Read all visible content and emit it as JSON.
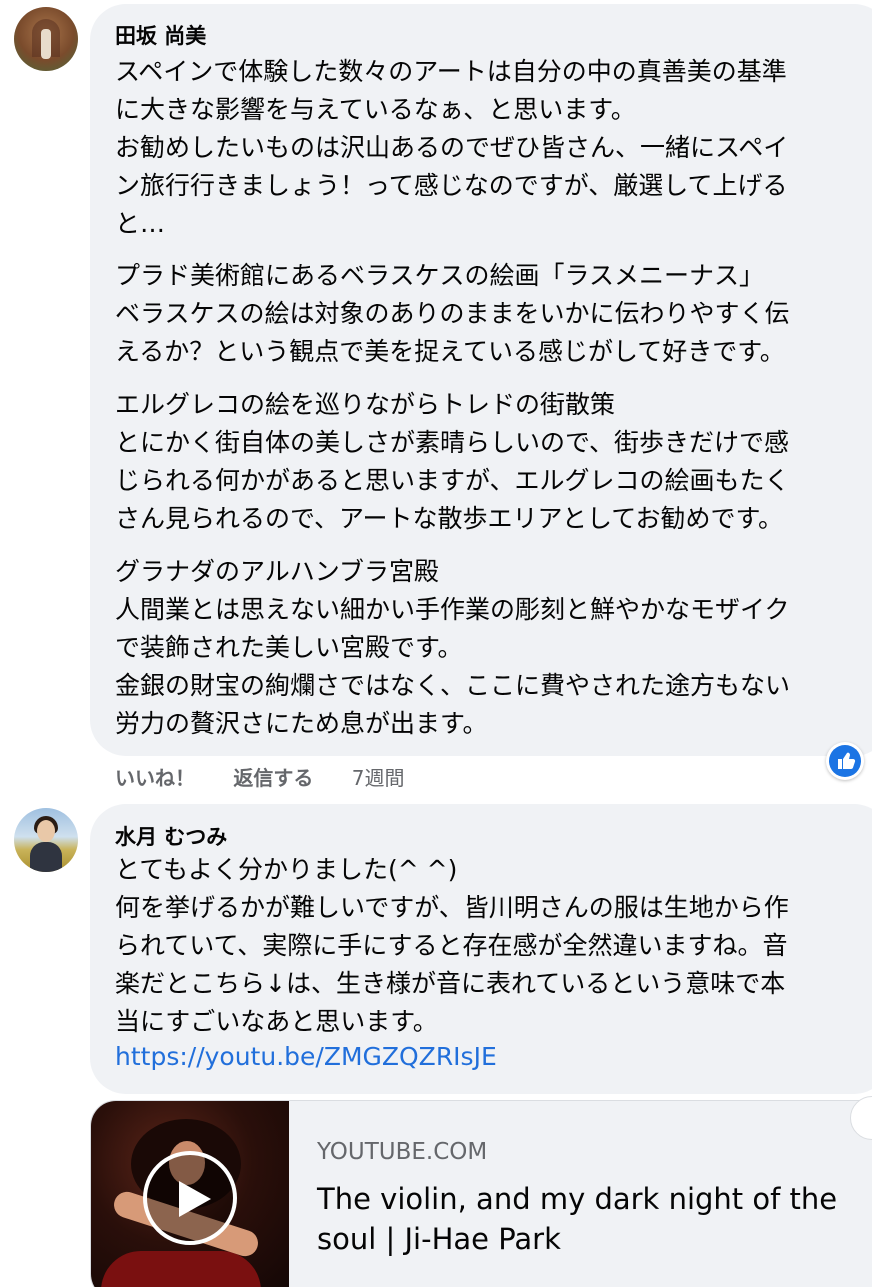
{
  "comments": [
    {
      "author": "田坂 尚美",
      "lines": [
        "スペインで体験した数々のアートは自分の中の真善美の基準",
        "に大きな影響を与えているなぁ、と思います。",
        "お勧めしたいものは沢山あるのでぜひ皆さん、一緒にスペイ",
        "ン旅行行きましょう！って感じなのですが、厳選して上げる",
        "と…"
      ],
      "para2": [
        "プラド美術館にあるベラスケスの絵画「ラスメニーナス」",
        "ベラスケスの絵は対象のありのままをいかに伝わりやすく伝",
        "えるか？という観点で美を捉えている感じがして好きです。"
      ],
      "para3": [
        "エルグレコの絵を巡りながらトレドの街散策",
        "とにかく街自体の美しさが素晴らしいので、街歩きだけで感",
        "じられる何かがあると思いますが、エルグレコの絵画もたく",
        "さん見られるので、アートな散歩エリアとしてお勧めです。"
      ],
      "para4": [
        "グラナダのアルハンブラ宮殿",
        "人間業とは思えない細かい手作業の彫刻と鮮やかなモザイク",
        "で装飾された美しい宮殿です。",
        "金銀の財宝の絢爛さではなく、ここに費やされた途方もない",
        "労力の贅沢さにため息が出ます。"
      ],
      "actions": {
        "like": "いいね！",
        "reply": "返信する",
        "time": "7週間"
      }
    },
    {
      "author": "水月 むつみ",
      "lines": [
        "とてもよく分かりました(^ ^)",
        "何を挙げるかが難しいですが、皆川明さんの服は生地から作",
        "られていて、実際に手にすると存在感が全然違いますね。音",
        "楽だとこちら↓は、生き様が音に表れているという意味で本",
        "当にすごいなあと思います。"
      ],
      "link": "https://youtu.be/ZMGZQZRIsJE",
      "card": {
        "domain": "YOUTUBE.COM",
        "title_lines": [
          "The violin, and my dark night of the",
          "soul | Ji-Hae Park"
        ]
      }
    }
  ],
  "icons": {
    "like_badge": "thumbs-up-icon",
    "play": "play-icon"
  },
  "colors": {
    "bubble": "#f0f2f5",
    "link": "#216fdb",
    "like": "#1b74e4",
    "meta": "#65676b"
  }
}
